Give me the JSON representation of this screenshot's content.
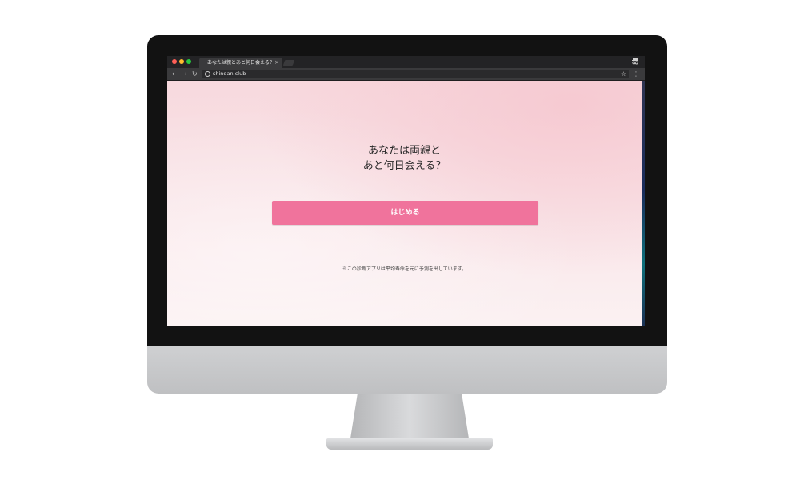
{
  "browser": {
    "tab_title": "あなたは親とあと何日会える？",
    "tab_close": "×",
    "url": "shindan.club",
    "icons": {
      "back": "arrow-left",
      "forward": "arrow-right",
      "reload": "reload",
      "info": "info",
      "star": "star",
      "menu": "kebab-menu",
      "profile": "incognito-profile"
    },
    "glyphs": {
      "back": "←",
      "forward": "→",
      "reload": "↻",
      "star": "☆",
      "menu": "⋮"
    }
  },
  "page": {
    "headline_line1": "あなたは両親と",
    "headline_line2": "あと何日会える？",
    "start_button_label": "はじめる",
    "disclaimer": "※この診断アプリは平均寿命を元に予測を出しています。"
  },
  "colors": {
    "button": "#f0739c",
    "page_background": "#f9e6e9",
    "browser_chrome": "#3a3a3c"
  }
}
